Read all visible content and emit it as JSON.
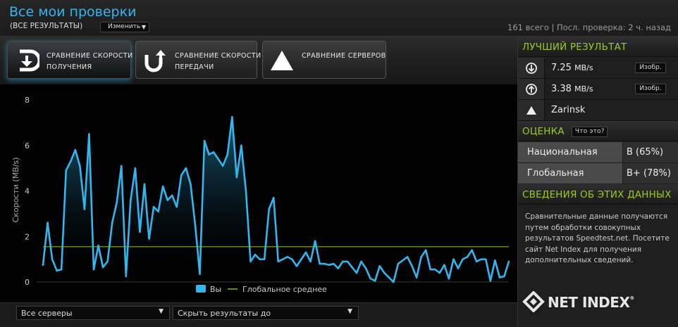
{
  "header": {
    "title": "Все мои проверки",
    "subtitle": "(ВСЕ РЕЗУЛЬТАТЫ)",
    "change_label": "Изменить",
    "summary": "161 всего | Посл. проверка: 2 ч. назад"
  },
  "tabs": [
    {
      "label": "Сравнение скорости получения",
      "icon": "download-arrow-icon"
    },
    {
      "label": "Сравнение скорости передачи",
      "icon": "upload-arrow-icon"
    },
    {
      "label": "Сравнение серверов",
      "icon": "triangle-icon"
    }
  ],
  "filters": {
    "servers": "Все серверы",
    "hide_results": "Скрыть результаты до"
  },
  "best": {
    "heading": "ЛУЧШИЙ РЕЗУЛЬТАТ",
    "download_value": "7.25",
    "download_unit": "MB/s",
    "upload_value": "3.38",
    "upload_unit": "MB/s",
    "image_label": "Изобр.",
    "server": "Zarinsk"
  },
  "rating": {
    "heading": "ОЦЕНКА",
    "whatis_label": "Что это?",
    "national_label": "Национальная",
    "national_value": "B (65%)",
    "global_label": "Глобальная",
    "global_value": "B+ (78%)"
  },
  "about": {
    "heading": "СВЕДЕНИЯ ОБ ЭТИХ ДАННЫХ",
    "text": "Сравнительные данные получаются путем обработки совокупных результатов Speedtest.net. Посетите сайт Net Index для получения дополнительных сведений.",
    "logo_text": "NET INDEX"
  },
  "colors": {
    "accent": "#33b6ee",
    "heading_green": "#9ccb1c",
    "average_line": "#8db51e"
  },
  "chart_data": {
    "type": "area",
    "ylabel": "Скорости (MB/s)",
    "ylim": [
      0,
      8
    ],
    "yticks": [
      0,
      2,
      4,
      6,
      8
    ],
    "grid": false,
    "legend_position": "bottom",
    "series": [
      {
        "name": "Вы",
        "values": [
          0.75,
          2.6,
          1.0,
          0.5,
          0.55,
          4.9,
          5.3,
          5.8,
          5.1,
          3.2,
          6.5,
          0.55,
          1.6,
          0.65,
          0.9,
          2.6,
          3.5,
          5.1,
          0.25,
          3.6,
          5.0,
          2.2,
          4.3,
          1.9,
          3.3,
          3.1,
          4.2,
          3.6,
          3.8,
          3.3,
          4.7,
          5.0,
          4.3,
          2.5,
          0.35,
          6.2,
          5.6,
          5.7,
          5.4,
          5.1,
          5.6,
          7.25,
          4.6,
          6.0,
          4.0,
          0.9,
          1.2,
          1.0,
          1.0,
          3.2,
          3.7,
          0.9,
          1.0,
          1.1,
          1.0,
          0.7,
          1.0,
          1.3,
          0.9,
          1.8,
          0.8,
          0.8,
          0.75,
          0.8,
          0.6,
          0.9,
          0.9,
          0.65,
          0.4,
          0.9,
          0.6,
          0.15,
          0.05,
          0.7,
          0.4,
          0.2,
          0.0,
          0.8,
          0.95,
          1.1,
          0.7,
          0.2,
          1.1,
          1.4,
          0.55,
          0.55,
          0.4,
          0.75,
          0.15,
          1.0,
          0.6,
          1.0,
          1.1,
          1.4,
          0.9,
          1.0,
          1.0,
          0.05,
          0.95,
          0.2,
          0.25,
          0.9
        ]
      },
      {
        "name": "Глобальное среднее",
        "values": [
          1.55
        ]
      }
    ]
  }
}
